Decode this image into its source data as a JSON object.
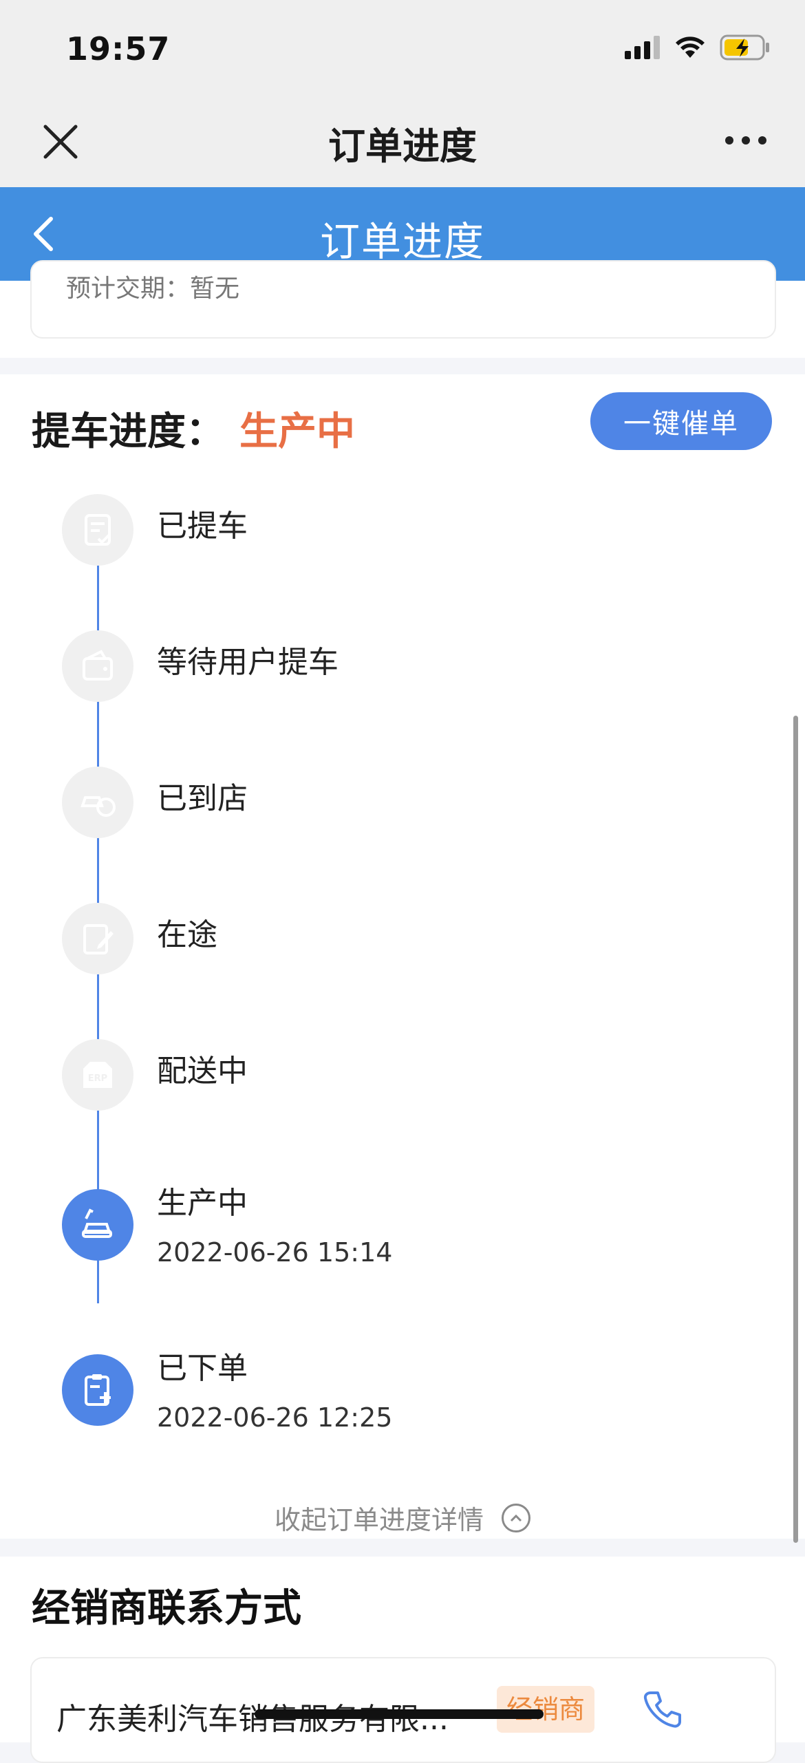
{
  "status_bar": {
    "time": "19:57"
  },
  "wechat_nav": {
    "title": "订单进度"
  },
  "app_header": {
    "title": "订单进度"
  },
  "order_card": {
    "eta_text": "预计交期：暂无"
  },
  "progress": {
    "heading": "提车进度：",
    "current_status": "生产中",
    "urge_button": "一键催单",
    "steps": [
      {
        "label": "已提车",
        "time": "",
        "active": false,
        "icon": "document-check-icon"
      },
      {
        "label": "等待用户提车",
        "time": "",
        "active": false,
        "icon": "wallet-icon"
      },
      {
        "label": "已到店",
        "time": "",
        "active": false,
        "icon": "car-store-icon"
      },
      {
        "label": "在途",
        "time": "",
        "active": false,
        "icon": "edit-document-icon"
      },
      {
        "label": "配送中",
        "time": "",
        "active": false,
        "icon": "erp-box-icon"
      },
      {
        "label": "生产中",
        "time": "2022-06-26 15:14",
        "active": true,
        "icon": "car-production-icon"
      },
      {
        "label": "已下单",
        "time": "2022-06-26 12:25",
        "active": true,
        "icon": "clipboard-add-icon"
      }
    ],
    "collapse_text": "收起订单进度详情"
  },
  "dealer": {
    "title": "经销商联系方式",
    "name": "广东美利汽车销售服务有限...",
    "tag": "经销商"
  },
  "colors": {
    "accent": "#428fe0",
    "button": "#4f85e6",
    "status_orange": "#e86f45"
  }
}
